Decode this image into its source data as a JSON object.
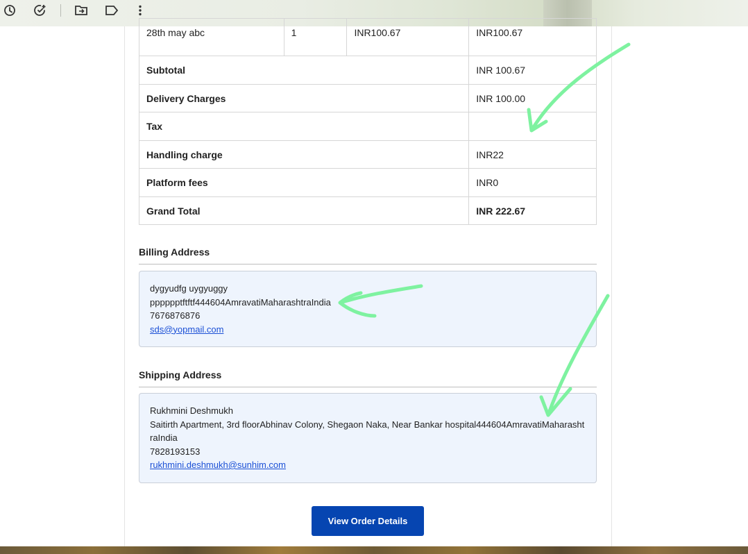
{
  "toolbar": {
    "icons": [
      "clock-icon",
      "add-task-icon",
      "move-to-folder-icon",
      "label-icon",
      "more-vert-icon"
    ]
  },
  "table": {
    "item_row": {
      "name": "28th may abc",
      "qty": "1",
      "price": "INR100.67",
      "total": "INR100.67"
    },
    "rows": [
      {
        "label": "Subtotal",
        "value": "INR 100.67"
      },
      {
        "label": "Delivery Charges",
        "value": "INR 100.00"
      },
      {
        "label": "Tax",
        "value": ""
      },
      {
        "label": "Handling charge",
        "value": "INR22"
      },
      {
        "label": "Platform fees",
        "value": "INR0"
      },
      {
        "label": "Grand Total",
        "value": "INR 222.67"
      }
    ]
  },
  "billing": {
    "title": "Billing Address",
    "name": "dygyudfg uygyuggy",
    "address": "pppppptftftf444604AmravatiMaharashtraIndia",
    "phone": "7676876876",
    "email": "sds@yopmail.com"
  },
  "shipping": {
    "title": "Shipping Address",
    "name": "Rukhmini Deshmukh",
    "address": "Saitirth Apartment, 3rd floorAbhinav Colony, Shegaon Naka, Near Bankar hospital444604AmravatiMaharashtraIndia",
    "phone": "7828193153",
    "email": "rukhmini.deshmukh@sunhim.com"
  },
  "actions": {
    "view_order": "View Order Details"
  },
  "colors": {
    "button": "#0645b1",
    "annotation": "#7ef2a0",
    "address_bg": "#eef4fd"
  }
}
